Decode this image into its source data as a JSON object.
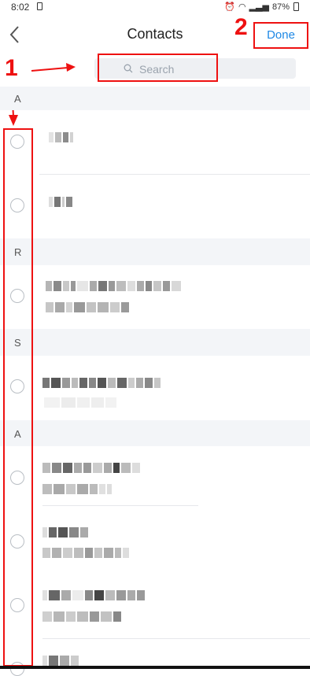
{
  "status": {
    "time": "8:02",
    "battery": "87%"
  },
  "header": {
    "back_label": "",
    "title": "Contacts",
    "done_label": "Done"
  },
  "search": {
    "placeholder": "Search"
  },
  "annotations": {
    "one": "1",
    "two": "2"
  },
  "sections": [
    "A",
    "R",
    "S",
    "A"
  ],
  "icons": {
    "back": "chevron-left-icon",
    "search": "search-icon",
    "radio": "radio-unchecked-icon"
  },
  "colors": {
    "accent": "#1e88e5",
    "annotation": "#ee1111",
    "section_bg": "#f3f5f8"
  }
}
